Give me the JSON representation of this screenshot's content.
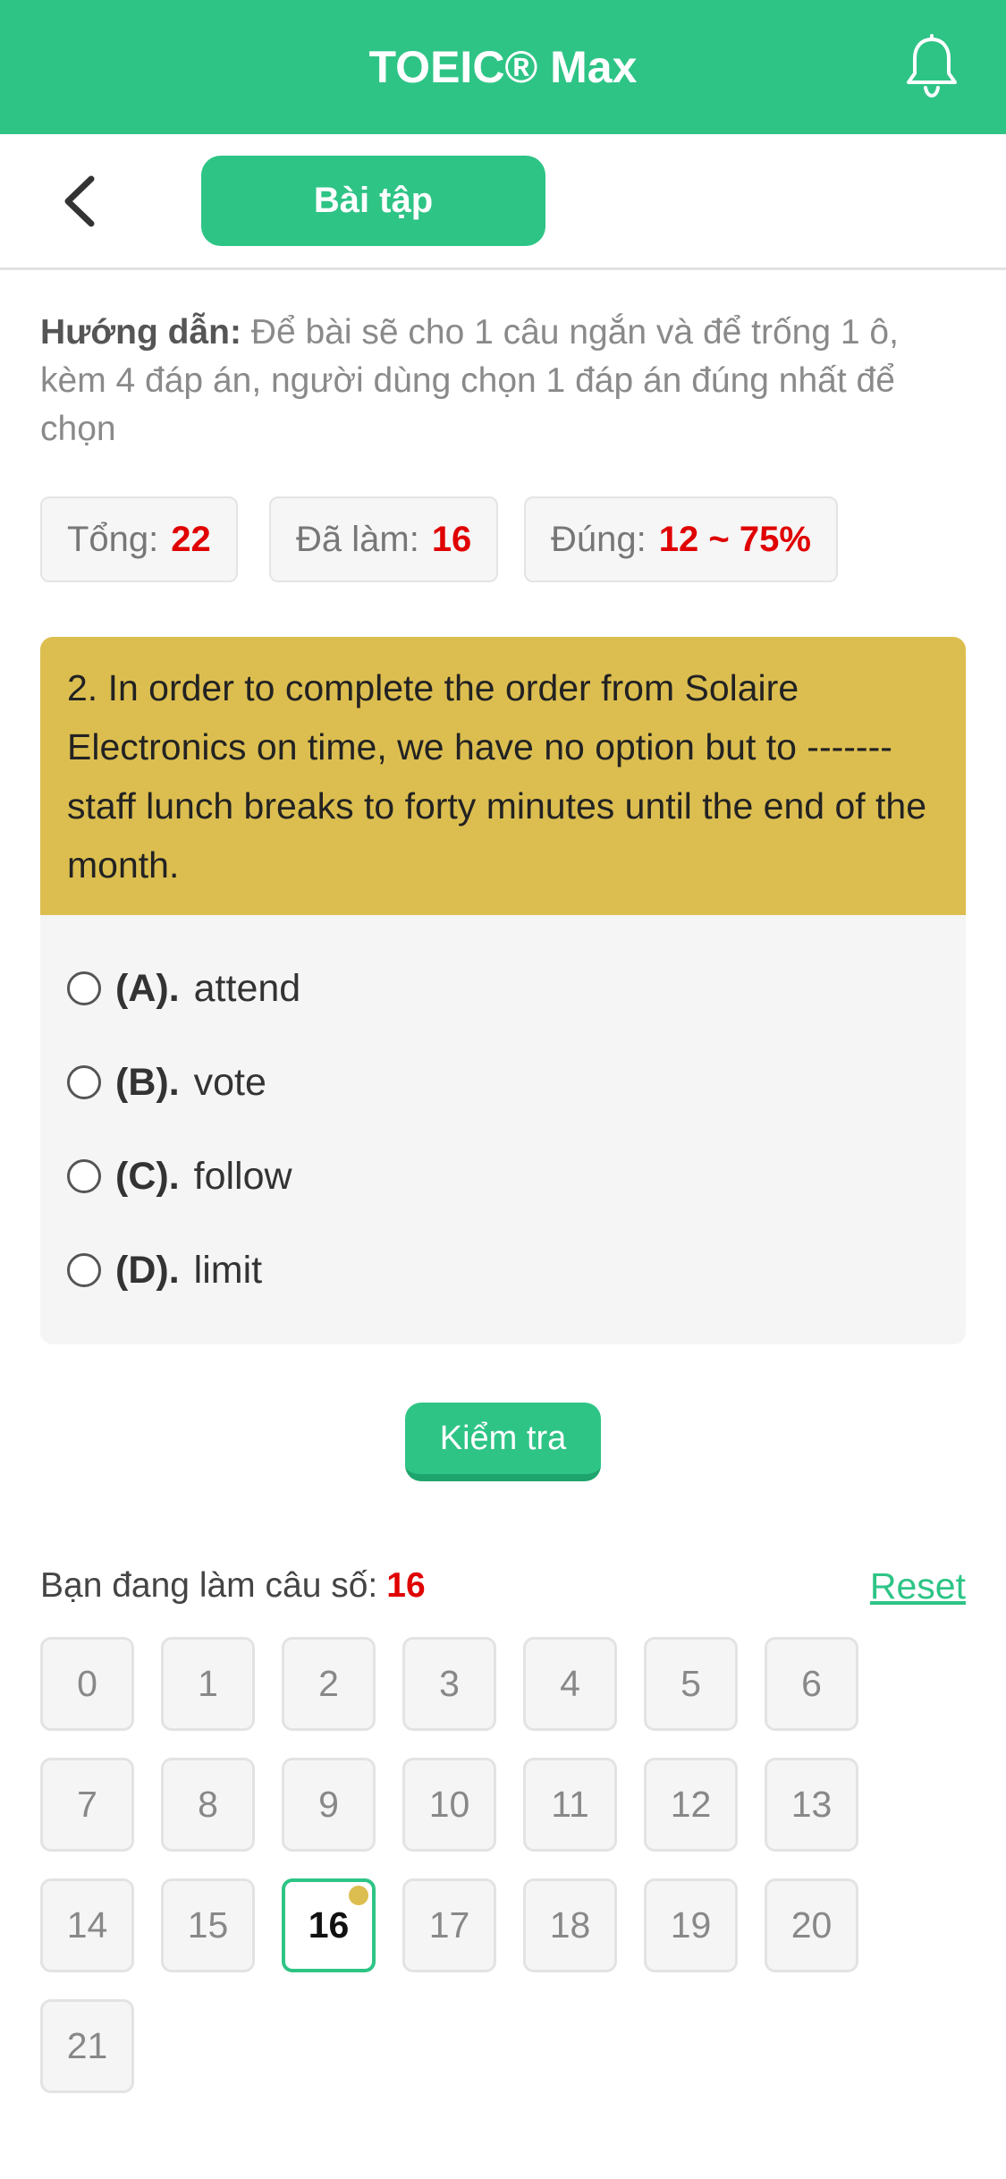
{
  "header": {
    "title": "TOEIC® Max",
    "icon": "bell-icon",
    "color": "#2ec486"
  },
  "subheader": {
    "back_icon": "chevron-left-icon",
    "tab_label": "Bài tập"
  },
  "instructions": {
    "label": "Hướng dẫn:",
    "text": "Để bài sẽ cho 1 câu ngắn và để trống 1 ô, kèm 4 đáp án, người dùng chọn 1 đáp án đúng nhất để chọn"
  },
  "stats": {
    "total_label": "Tổng:",
    "total_value": "22",
    "done_label": "Đã làm:",
    "done_value": "16",
    "correct_label": "Đúng:",
    "correct_value": "12 ~ 75%"
  },
  "question": {
    "text": "2. In order to complete the order from Solaire Electronics on time, we have no option but to ------- staff lunch breaks to forty minutes until the end of the month.",
    "options": [
      {
        "letter": "(A).",
        "text": "attend"
      },
      {
        "letter": "(B).",
        "text": "vote"
      },
      {
        "letter": "(C).",
        "text": "follow"
      },
      {
        "letter": "(D).",
        "text": "limit"
      }
    ]
  },
  "check_button": "Kiểm tra",
  "progress": {
    "label": "Bạn đang làm câu số:",
    "current": "16",
    "reset_label": "Reset"
  },
  "question_grid": [
    "0",
    "1",
    "2",
    "3",
    "4",
    "5",
    "6",
    "7",
    "8",
    "9",
    "10",
    "11",
    "12",
    "13",
    "14",
    "15",
    "16",
    "17",
    "18",
    "19",
    "20",
    "21"
  ],
  "colors": {
    "accent": "#2ec486",
    "question_bg": "#dcbe50",
    "highlight": "#e00000"
  }
}
